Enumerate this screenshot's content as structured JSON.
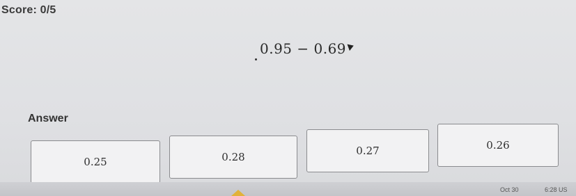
{
  "score": {
    "text": "Score: 0/5"
  },
  "problem": {
    "expression": "0.95 − 0.69"
  },
  "answer": {
    "label": "Answer",
    "choices": [
      "0.25",
      "0.28",
      "0.27",
      "0.26"
    ]
  },
  "taskbar": {
    "date": "Oct 30",
    "time": "6:28 US"
  },
  "colors": {
    "background": "#e2e3e5",
    "choice_fill": "#f2f2f3",
    "choice_border": "#8a8b8e"
  }
}
